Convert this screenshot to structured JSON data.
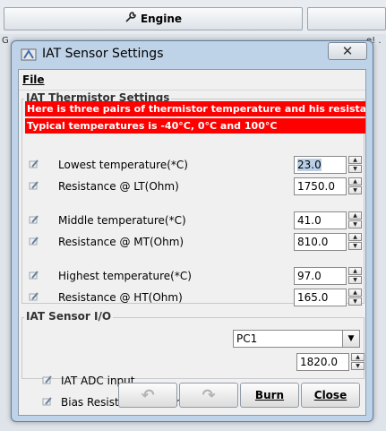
{
  "background": {
    "engine_button_label": "Engine",
    "strip_left": "G",
    "strip_right": "e! ."
  },
  "window": {
    "title": "IAT Sensor Settings",
    "close_glyph": "✕"
  },
  "menu": {
    "file_label": "File"
  },
  "thermistor": {
    "group_title": "IAT Thermistor Settings",
    "warning_line1": "Here is three pairs of thermistor temperature and his resistance.",
    "warning_line2": "Typical temperatures is -40°C, 0°C and 100°C",
    "rows": [
      {
        "label": "Lowest temperature(*C)",
        "value": "23.0"
      },
      {
        "label": "Resistance @ LT(Ohm)",
        "value": "1750.0"
      },
      {
        "label": "Middle temperature(*C)",
        "value": "41.0"
      },
      {
        "label": "Resistance @ MT(Ohm)",
        "value": "810.0"
      },
      {
        "label": "Highest temperature(*C)",
        "value": "97.0"
      },
      {
        "label": "Resistance @ HT(Ohm)",
        "value": "165.0"
      }
    ]
  },
  "io": {
    "group_title": "IAT Sensor I/O",
    "adc_label": "IAT ADC input",
    "adc_value": "PC1",
    "bias_label": "Bias Resistor Value(Ohm)",
    "bias_value": "1820.0"
  },
  "buttons": {
    "burn_label": "Burn",
    "close_label": "Close"
  },
  "colors": {
    "warning_bg": "#ff0000",
    "warning_text": "#ffffff",
    "selection": "#b9cfe6"
  }
}
